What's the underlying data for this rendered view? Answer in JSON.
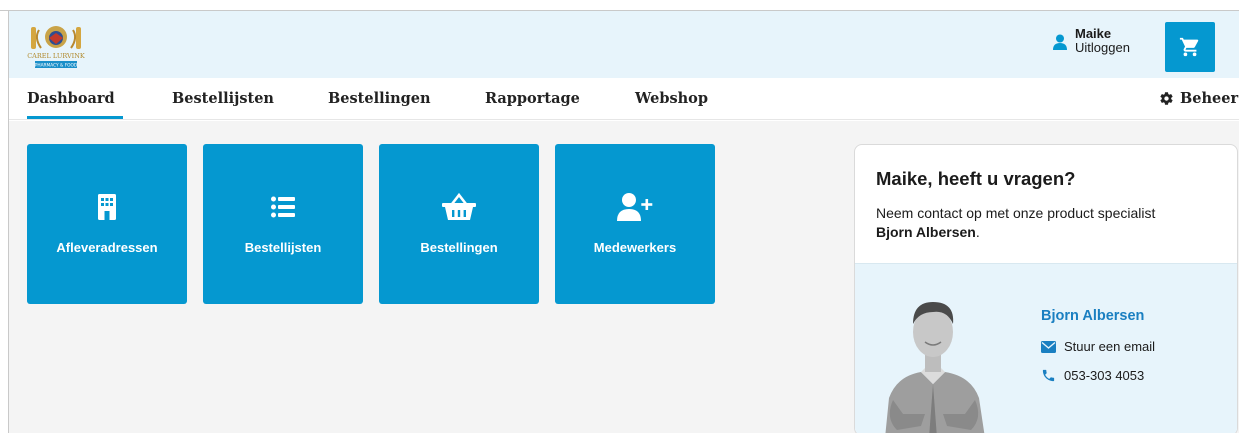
{
  "header": {
    "logo_text": "CAREL LURVINK",
    "logo_subtext": "PHARMACY & FOOD",
    "user_name": "Maike",
    "logout_label": "Uitloggen",
    "cart_icon": "cart-icon"
  },
  "nav": {
    "items": [
      "Dashboard",
      "Bestellijsten",
      "Bestellingen",
      "Rapportage",
      "Webshop"
    ],
    "active": "Dashboard",
    "beheer_label": "Beheer"
  },
  "tiles": [
    {
      "label": "Afleveradressen",
      "icon": "building-icon"
    },
    {
      "label": "Bestellijsten",
      "icon": "list-icon"
    },
    {
      "label": "Bestellingen",
      "icon": "basket-icon"
    },
    {
      "label": "Medewerkers",
      "icon": "user-plus-icon"
    }
  ],
  "contact": {
    "title": "Maike, heeft u vragen?",
    "text": "Neem contact op met onze product specialist",
    "specialist": "Bjorn Albersen",
    "name": "Bjorn Albersen",
    "email_label": "Stuur een email",
    "phone": "053-303 4053"
  },
  "colors": {
    "accent": "#0598d0",
    "header_bg": "#e7f4fb",
    "content_bg": "#f4f4f4",
    "link": "#1a7fc1"
  }
}
